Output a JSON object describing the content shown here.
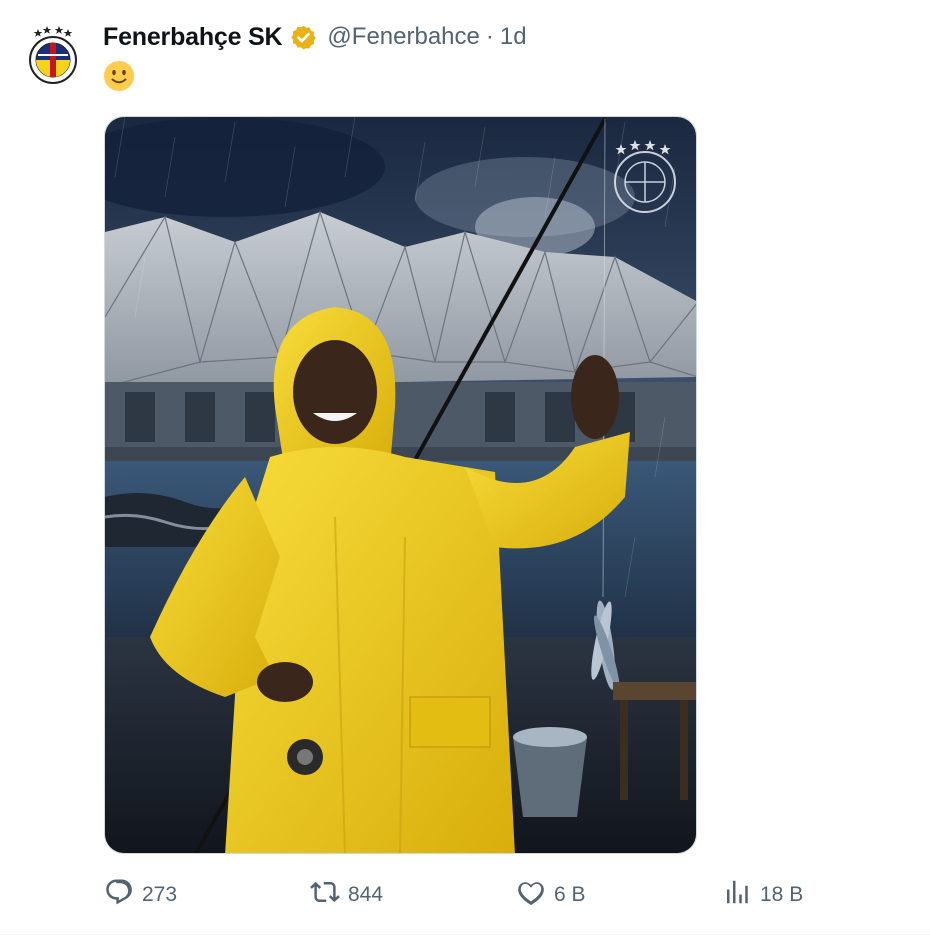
{
  "author": {
    "display_name": "Fenerbahçe SK",
    "handle": "@Fenerbahce",
    "separator": "·",
    "time": "1d",
    "avatar_icon": "fenerbahce-crest",
    "verified_icon": "gold-verified-badge",
    "verified_color": "#e8b116"
  },
  "tweet": {
    "emoji_icon": "slightly-smiling-face",
    "media_alt_icon": "player-in-yellow-raincoat-fishing-by-stadium"
  },
  "actions": {
    "replies": {
      "icon": "reply-icon",
      "count": "273"
    },
    "reposts": {
      "icon": "repost-icon",
      "count": "844"
    },
    "likes": {
      "icon": "heart-icon",
      "count": "6 B"
    },
    "views": {
      "icon": "views-icon",
      "count": "18 B"
    }
  },
  "colors": {
    "text_primary": "#0f1419",
    "text_secondary": "#536471",
    "raincoat_yellow": "#f2cf1e",
    "sky_dark": "#1e2d44"
  }
}
